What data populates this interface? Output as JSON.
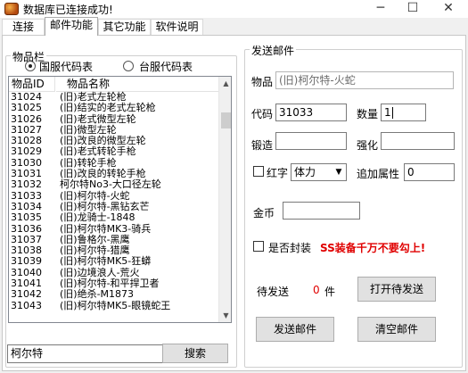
{
  "window": {
    "title": "数据库已连接成功!",
    "controls": [
      "─",
      "☐",
      "✕"
    ]
  },
  "tabs": [
    {
      "label": "连接"
    },
    {
      "label": "邮件功能"
    },
    {
      "label": "其它功能"
    },
    {
      "label": "软件说明"
    }
  ],
  "items_panel": {
    "legend": "物品栏",
    "radio_cn": "国服代码表",
    "radio_tw": "台服代码表",
    "columns": {
      "id": "物品ID",
      "name": "物品名称"
    },
    "rows": [
      {
        "id": "31024",
        "name": "(旧)老式左轮枪"
      },
      {
        "id": "31025",
        "name": "(旧)结实的老式左轮枪"
      },
      {
        "id": "31026",
        "name": "(旧)老式微型左轮"
      },
      {
        "id": "31027",
        "name": "(旧)微型左轮"
      },
      {
        "id": "31028",
        "name": "(旧)改良的微型左轮"
      },
      {
        "id": "31029",
        "name": "(旧)老式转轮手枪"
      },
      {
        "id": "31030",
        "name": "(旧)转轮手枪"
      },
      {
        "id": "31031",
        "name": "(旧)改良的转轮手枪"
      },
      {
        "id": "31032",
        "name": "柯尔特No3-大口径左轮"
      },
      {
        "id": "31033",
        "name": "(旧)柯尔特-火蛇"
      },
      {
        "id": "31034",
        "name": "(旧)柯尔特-黑钻玄芒"
      },
      {
        "id": "31035",
        "name": "(旧)龙骑士-1848"
      },
      {
        "id": "31036",
        "name": "(旧)柯尔特MK3-骑兵"
      },
      {
        "id": "31037",
        "name": "(旧)鲁格尔-黑鹰"
      },
      {
        "id": "31038",
        "name": "(旧)柯尔特-猎鹰"
      },
      {
        "id": "31039",
        "name": "(旧)柯尔特MK5-狂蟒"
      },
      {
        "id": "31040",
        "name": "(旧)边境浪人-荒火"
      },
      {
        "id": "31041",
        "name": "(旧)柯尔特-和平捍卫者"
      },
      {
        "id": "31042",
        "name": "(旧)绝杀-M1873"
      },
      {
        "id": "31043",
        "name": "(旧)柯尔特MK5-眼镜蛇王"
      }
    ],
    "search_value": "柯尔特",
    "search_button": "搜索"
  },
  "mail_panel": {
    "legend": "发送邮件",
    "item_label": "物品",
    "item_value": "(旧)柯尔特-火蛇",
    "code_label": "代码",
    "code_value": "31033",
    "qty_label": "数量",
    "qty_value": "1",
    "forge_label": "锻造",
    "forge_value": "",
    "enhance_label": "强化",
    "enhance_value": "",
    "redword_label": "红字",
    "redword_select": "体力",
    "extra_attr_label": "追加属性",
    "extra_attr_value": "0",
    "gold_label": "金币",
    "gold_value": "",
    "seal_label": "是否封装",
    "warning": "SS装备千万不要勾上!",
    "pending_label": "待发送",
    "pending_count": "0",
    "pending_unit": "件",
    "open_pending_button": "打开待发送",
    "send_button": "发送邮件",
    "clear_button": "清空邮件"
  }
}
